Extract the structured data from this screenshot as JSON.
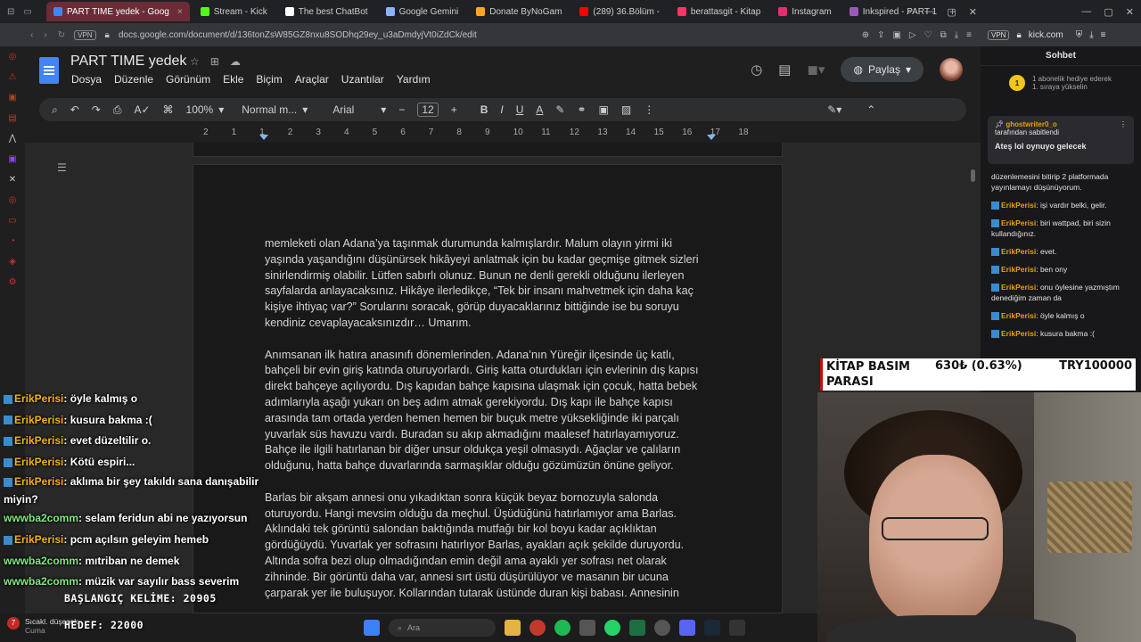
{
  "browser": {
    "tabs": [
      {
        "label": "PART TIME yedek - Goog",
        "active": true,
        "color": "#4285f4"
      },
      {
        "label": "Stream - Kick",
        "color": "#53fc18"
      },
      {
        "label": "The best ChatBot",
        "color": "#ffffff"
      },
      {
        "label": "Google Gemini",
        "color": "#8ab4f8"
      },
      {
        "label": "Donate ByNoGam",
        "color": "#f5a623"
      },
      {
        "label": "(289) 36.Bölüm -",
        "color": "#ff0000"
      },
      {
        "label": "berattasgit - Kitap",
        "color": "#ff3366"
      },
      {
        "label": "Instagram",
        "color": "#e1306c"
      },
      {
        "label": "Inkspired - PART 1",
        "color": "#9b59b6"
      }
    ],
    "url": "docs.google.com/document/d/136tonZsW85GZ8nxu8SODhq29ey_u3aDmdyjVt0iZdCk/edit",
    "vpn": "VPN",
    "side_url": "kick.com"
  },
  "docs": {
    "title": "PART TIME yedek",
    "menus": [
      "Dosya",
      "Düzenle",
      "Görünüm",
      "Ekle",
      "Biçim",
      "Araçlar",
      "Uzantılar",
      "Yardım"
    ],
    "share_label": "Paylaş",
    "zoom": "100%",
    "style": "Normal m...",
    "font": "Arial",
    "font_size": "12",
    "ruler": [
      "2",
      "1",
      "1",
      "2",
      "3",
      "4",
      "5",
      "6",
      "7",
      "8",
      "9",
      "10",
      "11",
      "12",
      "13",
      "14",
      "15",
      "16",
      "17",
      "18"
    ],
    "paragraphs": [
      "memleketi olan Adana’ya taşınmak durumunda kalmışlardır. Malum olayın yirmi iki yaşında yaşandığını düşünürsek hikâyeyi anlatmak için bu kadar geçmişe gitmek sizleri sinirlendirmiş olabilir. Lütfen sabırlı olunuz. Bunun ne denli gerekli olduğunu ilerleyen sayfalarda anlayacaksınız. Hikâye ilerledikçe, “Tek bir insanı mahvetmek için daha kaç kişiye ihtiyaç var?” Sorularını soracak, görüp duyacaklarınız bittiğinde ise bu soruyu kendiniz cevaplayacaksınızdır… Umarım.",
      "Anımsanan ilk hatıra anasınıfı dönemlerinden. Adana’nın Yüreğir ilçesinde üç katlı, bahçeli bir evin giriş katında oturuyorlardı. Giriş katta oturdukları için evlerinin dış kapısı direkt bahçeye açılıyordu. Dış kapıdan bahçe kapısına ulaşmak için çocuk, hatta bebek adımlarıyla aşağı yukarı on beş adım atmak gerekiyordu. Dış kapı ile bahçe kapısı arasında tam ortada yerden hemen hemen bir buçuk metre yüksekliğinde iki parçalı yuvarlak süs havuzu vardı. Buradan su akıp akmadığını maalesef hatırlayamıyoruz. Bahçe ile ilgili hatırlanan bir diğer unsur oldukça yeşil olmasıydı. Ağaçlar ve çalıların olduğunu, hatta bahçe duvarlarında sarmaşıklar olduğu gözümüzün önüne geliyor.",
      "Barlas bir akşam annesi onu yıkadıktan sonra küçük beyaz bornozuyla salonda oturuyordu. Hangi mevsim olduğu da meçhul. Üşüdüğünü hatırlamıyor ama Barlas. Aklındaki tek görüntü salondan baktığında mutfağı bir kol boyu kadar açıklıktan gördüğüydü. Yuvarlak yer sofrasını hatırlıyor Barlas, ayakları açık şekilde duruyordu. Altında sofra bezi olup olmadığından emin değil ama ayaklı yer sofrası net olarak zihninde. Bir görüntü daha var, annesi sırt üstü düşürülüyor ve masanın bir ucuna çarparak yer ile buluşuyor. Kollarından tutarak üstünde duran kişi babası. Annesinin"
    ]
  },
  "kick_chat": {
    "header": "Sohbet",
    "subgoal": "1 abonelik hediye ederek 1. sıraya yükselin",
    "subgoal_rank": "1",
    "pinned_user": "ghostwriter0_o",
    "pinned_by": "tarafından sabitlendi",
    "pinned_msg": "Ateş lol oynuyo gelecek",
    "intro": "düzenlemesini bitirip 2 platformada yayınlamayı düşünüyorum.",
    "messages": [
      {
        "user": "ErikPerisi",
        "text": ": işi vardır belki, gelir."
      },
      {
        "user": "ErikPerisi",
        "text": ": biri wattpad, biri sizin kullandığınız."
      },
      {
        "user": "ErikPerisi",
        "text": ": evet."
      },
      {
        "user": "ErikPerisi",
        "text": ": ben ony"
      },
      {
        "user": "ErikPerisi",
        "text": ": onu öylesine yazmıştım denediğim zaman da"
      },
      {
        "user": "ErikPerisi",
        "text": ": öyle kalmış o"
      },
      {
        "user": "ErikPerisi",
        "text": ": kusura bakma :("
      }
    ]
  },
  "goal_overlay": {
    "label": "KİTAP BASIM PARASI",
    "current": "630₺ (0.63%)",
    "target": "TRY100000",
    "progress": 0.0063
  },
  "stream_chat": [
    {
      "user": "ErikPerisi",
      "text": ": öyle kalmış o",
      "color": "#f0b414"
    },
    {
      "user": "ErikPerisi",
      "text": ": kusura bakma :(",
      "color": "#f0b414"
    },
    {
      "user": "ErikPerisi",
      "text": ": evet düzeltilir o.",
      "color": "#f0b414"
    },
    {
      "user": "ErikPerisi",
      "text": ": Kötü espiri...",
      "color": "#f0b414"
    },
    {
      "user": "ErikPerisi",
      "text": ": aklıma bir şey takıldı sana danışabilir miyin?",
      "color": "#f0b414"
    },
    {
      "user": "wwwba2comm",
      "text": ": selam feridun abi ne yazıyorsun",
      "color": "#7ee87e"
    },
    {
      "user": "ErikPerisi",
      "text": ": pcm açılsın geleyim hemeb",
      "color": "#f0b414"
    },
    {
      "user": "wwwba2comm",
      "text": ": mıtriban ne demek",
      "color": "#7ee87e"
    },
    {
      "user": "wwwba2comm",
      "text": ": müzik var sayılır bass severim",
      "color": "#7ee87e"
    }
  ],
  "counters": {
    "start": "BAŞLANGIÇ KELİME: 20905",
    "goal": "HEDEF: 22000"
  },
  "taskbar": {
    "weather_title": "Sıcakl. düşecek",
    "weather_sub": "Cuma",
    "search": "Ara"
  }
}
